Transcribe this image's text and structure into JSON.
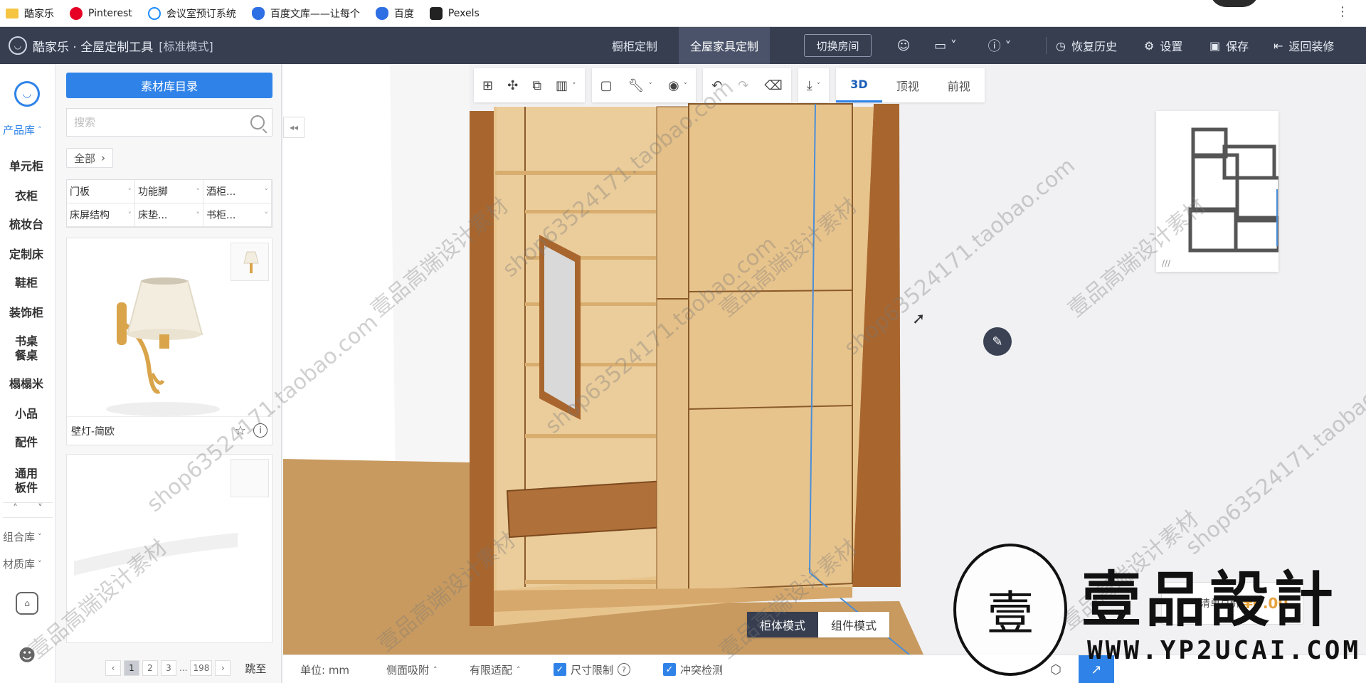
{
  "bookmarks": [
    {
      "label": "酷家乐",
      "icon": "folder-icon"
    },
    {
      "label": "Pinterest",
      "icon": "pinterest-icon"
    },
    {
      "label": "会议室预订系统",
      "icon": "kujiale-icon"
    },
    {
      "label": "百度文库——让每个",
      "icon": "baidu-icon"
    },
    {
      "label": "百度",
      "icon": "baidu-icon"
    },
    {
      "label": "Pexels",
      "icon": "pexels-icon"
    }
  ],
  "header": {
    "app_name": "酷家乐 · 全屋定制工具",
    "mode": "[标准模式]",
    "tab_cabinet": "橱柜定制",
    "tab_furniture": "全屋家具定制",
    "switch_room": "切换房间",
    "restore_history": "恢复历史",
    "settings": "设置",
    "save": "保存",
    "back": "返回装修"
  },
  "rail": {
    "product_lib": "产品库",
    "items": [
      "单元柜",
      "衣柜",
      "梳妆台",
      "定制床",
      "鞋柜",
      "装饰柜",
      "书桌\n餐桌",
      "榻榻米",
      "小品",
      "配件",
      "通用\n板件"
    ],
    "combo_lib": "组合库",
    "material_lib": "材质库"
  },
  "panel": {
    "catalog_button": "素材库目录",
    "search_placeholder": "搜索",
    "filter_all": "全部",
    "categories": [
      "门板",
      "功能脚",
      "酒柜...",
      "床屏结构",
      "床垫...",
      "书柜..."
    ],
    "product_name": "壁灯-简欧",
    "pager": {
      "pages": [
        "1",
        "2",
        "3",
        "...",
        "198"
      ],
      "jump": "跳至"
    }
  },
  "toolbar": {
    "view_3d": "3D",
    "view_top": "顶视",
    "view_front": "前视"
  },
  "mode_toggle": {
    "cabinet_mode": "柜体模式",
    "component_mode": "组件模式"
  },
  "status_bar": {
    "unit": "单位: mm",
    "side_snap": "侧面吸附",
    "limited_fit": "有限适配",
    "size_limit": "尺寸限制",
    "conflict_check": "冲突检测"
  },
  "price": {
    "label": "清单总价",
    "value": "¥0.00"
  },
  "brand": {
    "seal": "壹",
    "title": "壹品設計",
    "url": "WWW.YP2UCAI.COM",
    "watermark_a": "壹品高端设计素材",
    "watermark_b": "shop63524171.taobao.com"
  },
  "colors": {
    "header_bg": "#363e50",
    "accent_blue": "#2f83e8",
    "wood_frame": "#a8662e",
    "panel_maple": "#e8c48d",
    "floor": "#c89a5f"
  }
}
